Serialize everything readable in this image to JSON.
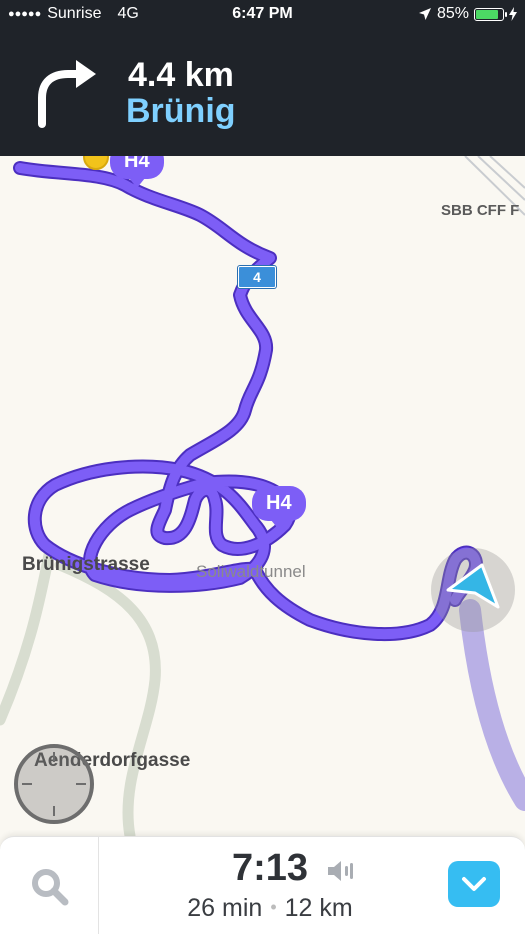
{
  "status_bar": {
    "signal": "●●●●●",
    "carrier": "Sunrise",
    "network": "4G",
    "time": "6:47 PM",
    "battery_percent": "85%",
    "battery_level": 0.85
  },
  "navigation": {
    "distance": "4.4 km",
    "street": "Brünig",
    "turn_direction": "turn-right-icon"
  },
  "map": {
    "labels": {
      "brunigstrasse": "Brünigstrasse",
      "soliwaldtunnel": "Soliwaldtunnel",
      "aenderdorfgasse": "Aenderdorfgasse",
      "sbb": "SBB CFF F"
    },
    "route_badges": [
      "H4",
      "H4"
    ],
    "road_shield": "4",
    "colors": {
      "route": "#7d5ef6",
      "route_outline": "#5436c9",
      "background": "#faf8f2",
      "secondary_road": "#d7dccf",
      "arrow": "#34b6e6"
    }
  },
  "bottom_bar": {
    "eta": "7:13",
    "duration": "26 min",
    "separator": "•",
    "distance": "12 km"
  }
}
